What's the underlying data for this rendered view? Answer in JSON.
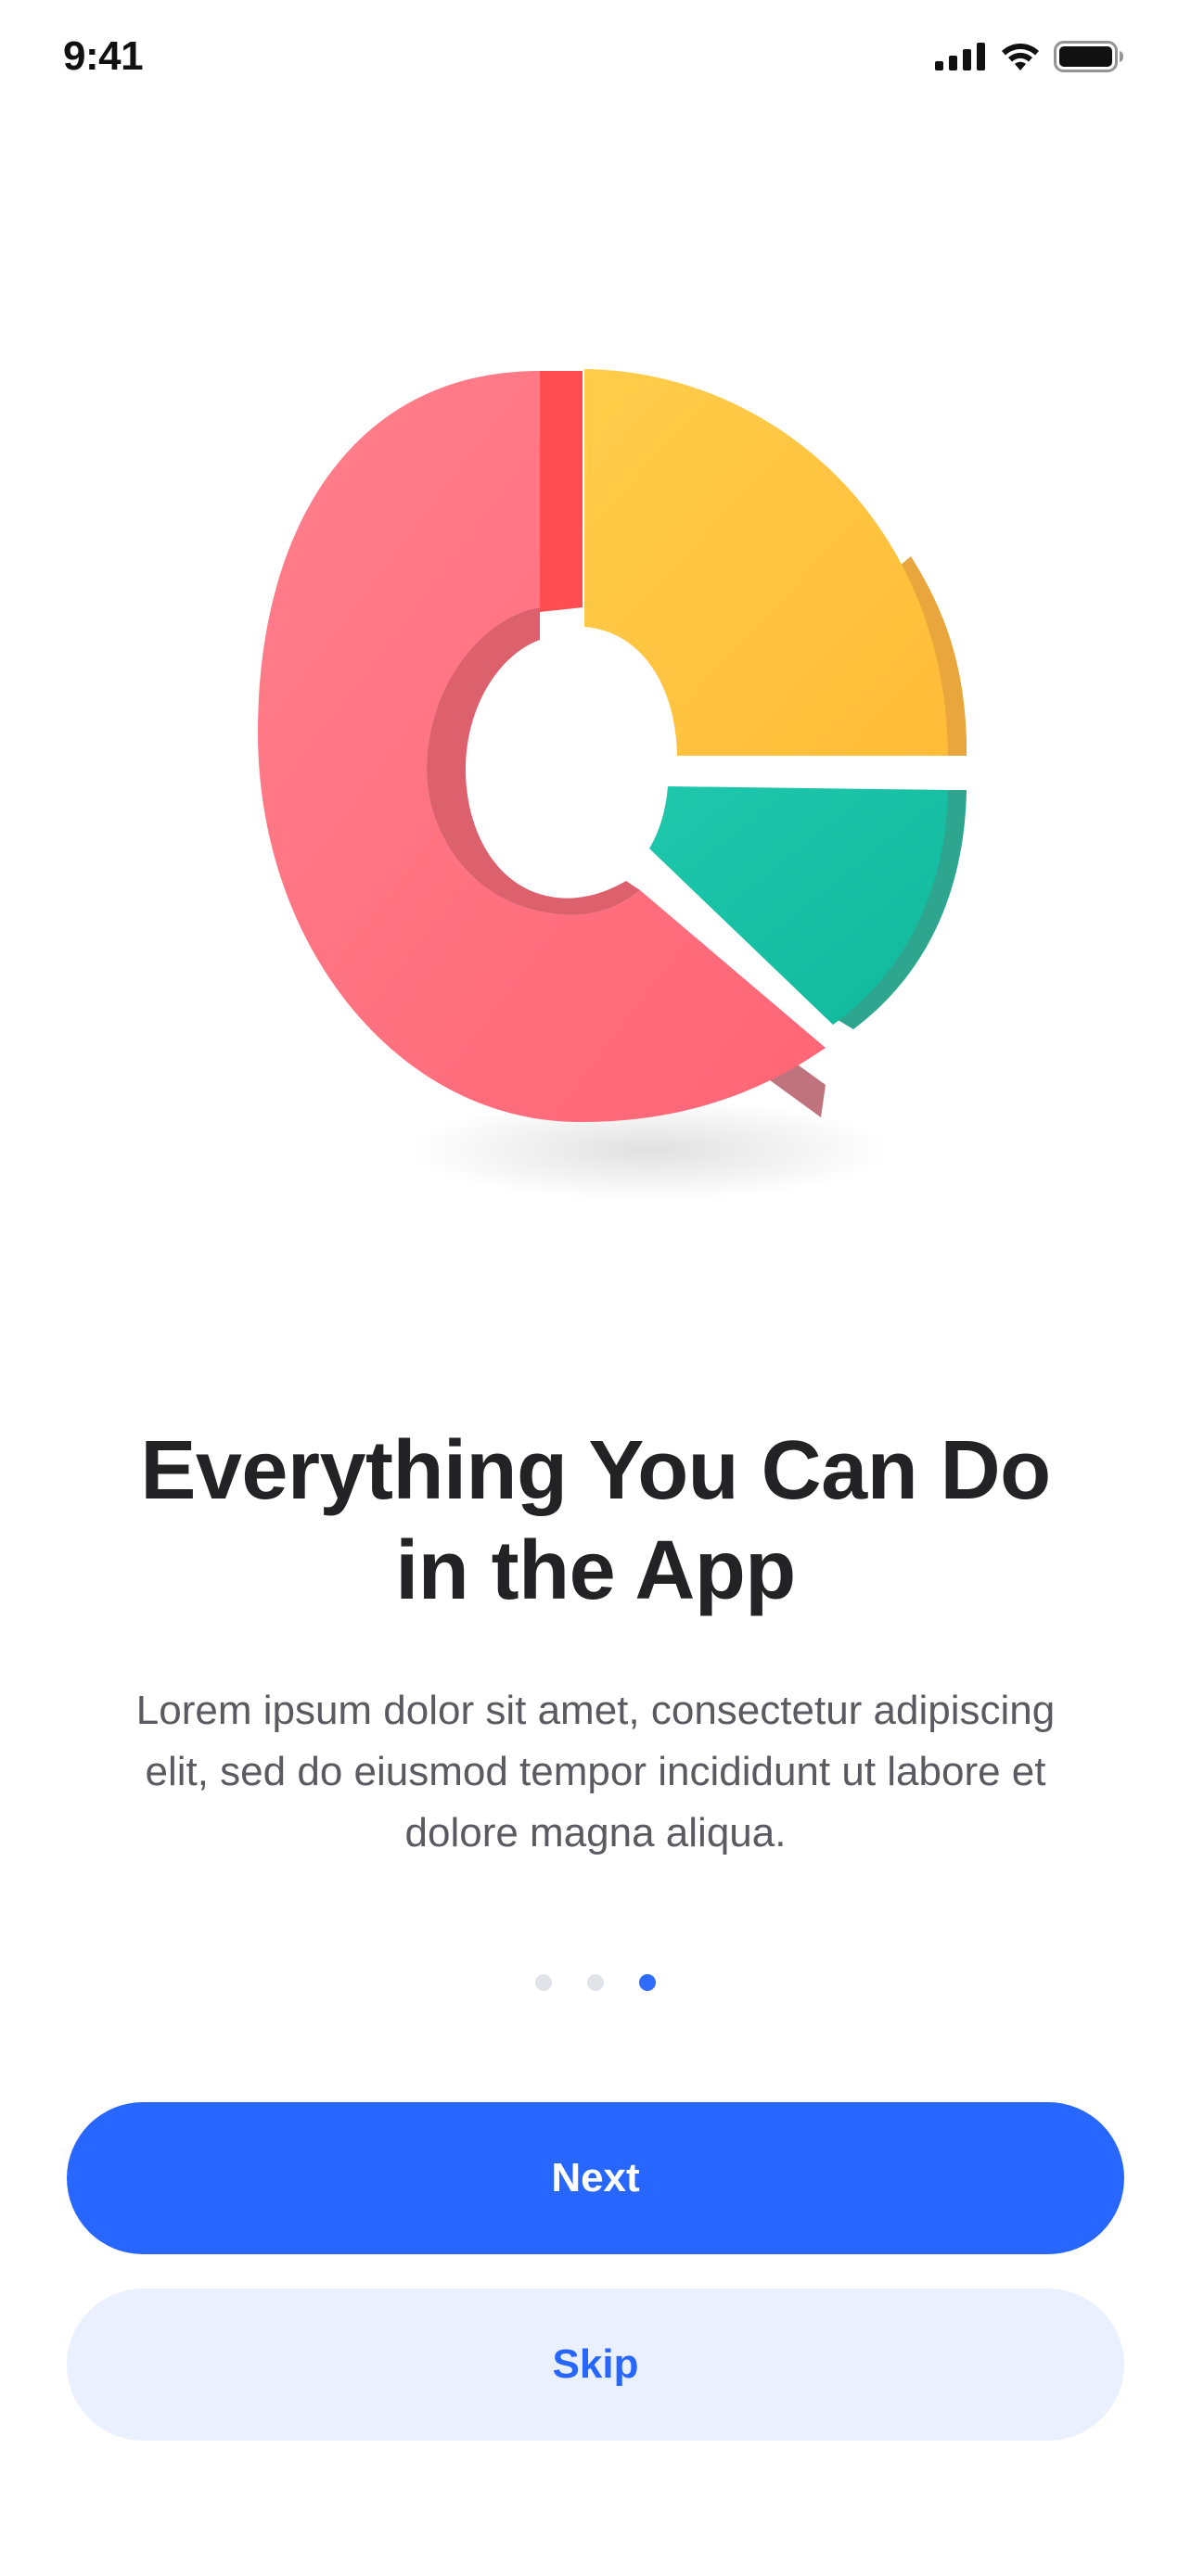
{
  "status_bar": {
    "time": "9:41",
    "icons": [
      "cellular-signal-icon",
      "wifi-icon",
      "battery-icon"
    ]
  },
  "illustration": {
    "name": "donut-chart-3d-illustration",
    "colors": {
      "red": "#ff6b78",
      "yellow": "#ffc53f",
      "teal": "#18bfa4"
    }
  },
  "onboarding": {
    "title_line1": "Everything You Can Do",
    "title_line2": "in the App",
    "subtitle_line1": "Lorem ipsum dolor sit amet, consectetur adipiscing",
    "subtitle_line2": "elit, sed do eiusmod tempor incididunt ut labore et",
    "subtitle_line3": "dolore magna aliqua.",
    "pages_total": 3,
    "current_page": 3
  },
  "buttons": {
    "next_label": "Next",
    "skip_label": "Skip"
  },
  "colors": {
    "primary": "#2867ff",
    "secondary_bg": "#eaf0fd",
    "dot_inactive": "#e1e3e8"
  }
}
